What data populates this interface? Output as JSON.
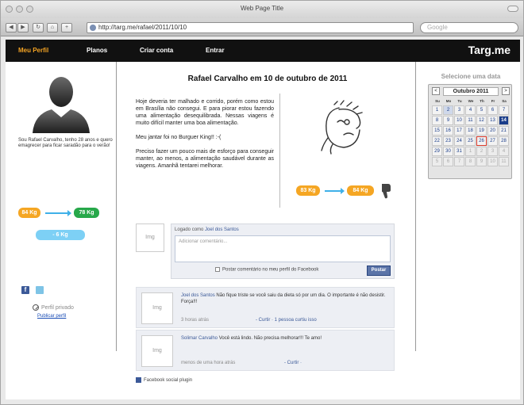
{
  "browser": {
    "window_title": "Web Page Title",
    "url": "http://targ.me/rafael/2011/10/10",
    "search_placeholder": "Google"
  },
  "nav": {
    "items": [
      "Meu Perfil",
      "Planos",
      "Criar conta",
      "Entrar"
    ],
    "brand": "Targ.me"
  },
  "profile": {
    "bio": "Sou Rafael Carvalho, tenho 28 anos e quero emagrecer para ficar saradão para o verão!",
    "weight_from": "84 Kg",
    "weight_to": "78 Kg",
    "weight_diff": "- 6 Kg",
    "private_label": "Perfil privado",
    "publish_link": "Publicar perfil"
  },
  "post": {
    "title": "Rafael Carvalho em 10 de outubro de 2011",
    "paragraphs": [
      "Hoje deveria ter malhado e corrido, porém como estou em Brasília não consegui. E para piorar estou fazendo uma alimentação desequilibrada. Nessas viagens é muito difícil manter uma boa alimentação.",
      "Meu jantar foi no Burguer King!! :-(",
      "Preciso fazer um pouco mais de esforço para conseguir manter, ao menos, a alimentação saudável durante as viagens. Amanhã tentarei melhorar."
    ],
    "weight_from": "83 Kg",
    "weight_to": "84 Kg"
  },
  "comments": {
    "img_label": "Img",
    "logged_prefix": "Logado como ",
    "logged_user": "Joel dos Santos",
    "textarea_placeholder": "Adicionar comentário...",
    "facebook_check": "Postar comentário no meu perfil do Facebook",
    "post_button": "Postar",
    "list": [
      {
        "author": "Joel dos Santos",
        "text": " Não fique triste se você saiu da dieta só por um dia. O importante é não desistir. Força!!!",
        "time": "3 horas atrás",
        "actions": "- Curtir · 1 pessoa curtiu isso"
      },
      {
        "author": "Solimar Carvalho",
        "text": " Você está lindo. Não precisa melhorar!!! Te amo!",
        "time": "menos de uma hora atrás",
        "actions": "- Curtir ·"
      }
    ],
    "plugin": "Facebook social plugin"
  },
  "calendar": {
    "title": "Selecione uma data",
    "month": "Outubro 2011",
    "prev": "<",
    "next": ">",
    "dows": [
      "Su",
      "Mo",
      "Tu",
      "We",
      "Th",
      "Fr",
      "Sa"
    ],
    "days": [
      {
        "d": "1",
        "s": "n"
      },
      {
        "d": "2",
        "s": "hl"
      },
      {
        "d": "3",
        "s": "n"
      },
      {
        "d": "4",
        "s": "n"
      },
      {
        "d": "5",
        "s": "n"
      },
      {
        "d": "6",
        "s": "n"
      },
      {
        "d": "7",
        "s": "n"
      },
      {
        "d": "8",
        "s": "n"
      },
      {
        "d": "9",
        "s": "n"
      },
      {
        "d": "10",
        "s": "n"
      },
      {
        "d": "11",
        "s": "n"
      },
      {
        "d": "12",
        "s": "n"
      },
      {
        "d": "13",
        "s": "n"
      },
      {
        "d": "14",
        "s": "today"
      },
      {
        "d": "15",
        "s": "n"
      },
      {
        "d": "16",
        "s": "n"
      },
      {
        "d": "17",
        "s": "n"
      },
      {
        "d": "18",
        "s": "n"
      },
      {
        "d": "19",
        "s": "n"
      },
      {
        "d": "20",
        "s": "n"
      },
      {
        "d": "21",
        "s": "n"
      },
      {
        "d": "22",
        "s": "n"
      },
      {
        "d": "23",
        "s": "n"
      },
      {
        "d": "24",
        "s": "n"
      },
      {
        "d": "25",
        "s": "n"
      },
      {
        "d": "26",
        "s": "sel"
      },
      {
        "d": "27",
        "s": "n"
      },
      {
        "d": "28",
        "s": "n"
      },
      {
        "d": "29",
        "s": "n"
      },
      {
        "d": "30",
        "s": "n"
      },
      {
        "d": "31",
        "s": "n"
      },
      {
        "d": "1",
        "s": "out"
      },
      {
        "d": "2",
        "s": "out"
      },
      {
        "d": "3",
        "s": "out"
      },
      {
        "d": "4",
        "s": "out"
      },
      {
        "d": "5",
        "s": "out"
      },
      {
        "d": "6",
        "s": "out"
      },
      {
        "d": "7",
        "s": "out"
      },
      {
        "d": "8",
        "s": "out"
      },
      {
        "d": "9",
        "s": "out"
      },
      {
        "d": "10",
        "s": "out"
      },
      {
        "d": "11",
        "s": "out"
      }
    ]
  },
  "colors": {
    "accent_orange": "#f5a623",
    "green": "#27a84a",
    "light_blue": "#7dd0f5",
    "facebook_blue": "#3b5998",
    "calendar_selected": "#1a3d8a"
  }
}
